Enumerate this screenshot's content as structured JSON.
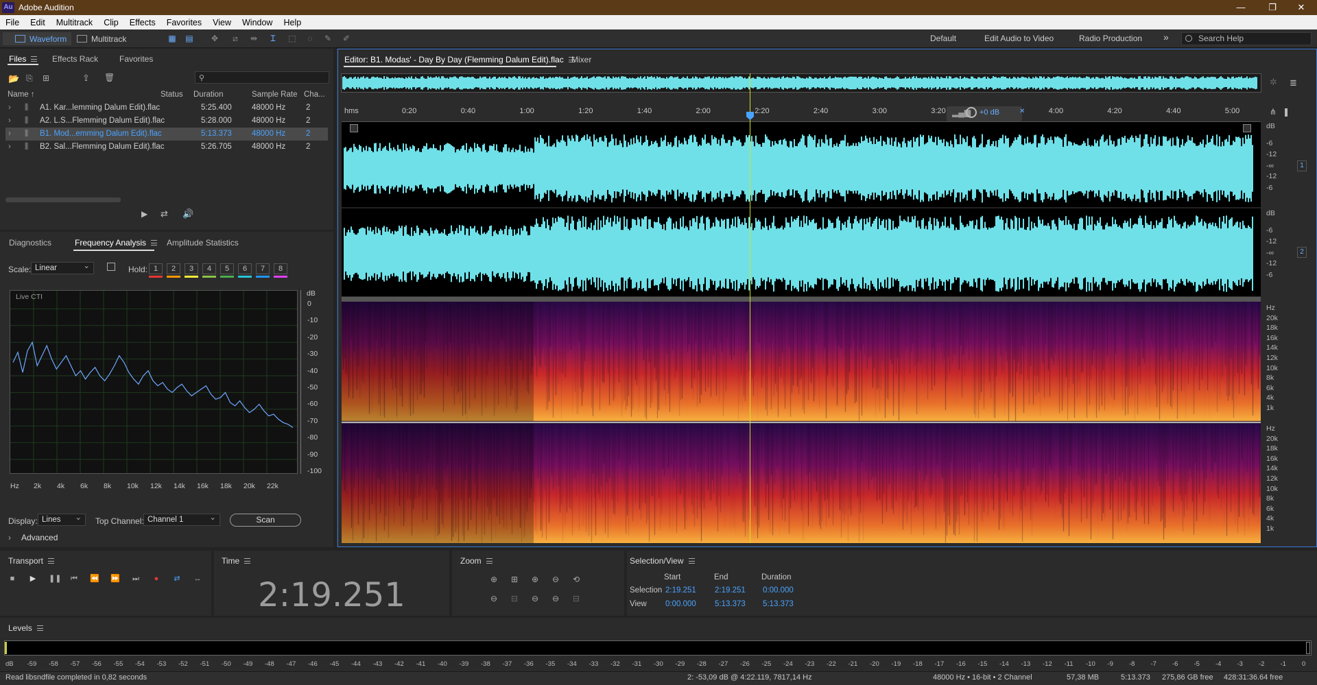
{
  "app": {
    "title": "Adobe Audition",
    "icon_label": "Au"
  },
  "window_controls": [
    "—",
    "❐",
    "✕"
  ],
  "menu": [
    "File",
    "Edit",
    "Multitrack",
    "Clip",
    "Effects",
    "Favorites",
    "View",
    "Window",
    "Help"
  ],
  "toolbar": {
    "waveform": "Waveform",
    "multitrack": "Multitrack",
    "workspaces": [
      "Default",
      "Edit Audio to Video",
      "Radio Production"
    ],
    "more": "»",
    "search_placeholder": "Search Help"
  },
  "files_panel": {
    "tabs": [
      "Files",
      "Effects Rack",
      "Favorites"
    ],
    "columns": [
      "Name ↑",
      "Status",
      "Duration",
      "Sample Rate",
      "Cha..."
    ],
    "rows": [
      {
        "name": "A1. Kar...lemming Dalum Edit).flac",
        "duration": "5:25.400",
        "rate": "48000 Hz",
        "ch": "2"
      },
      {
        "name": "A2. L.S...Flemming Dalum Edit).flac",
        "duration": "5:28.000",
        "rate": "48000 Hz",
        "ch": "2"
      },
      {
        "name": "B1. Mod...emming Dalum Edit).flac",
        "duration": "5:13.373",
        "rate": "48000 Hz",
        "ch": "2"
      },
      {
        "name": "B2. Sal...Flemming Dalum Edit).flac",
        "duration": "5:26.705",
        "rate": "48000 Hz",
        "ch": "2"
      }
    ],
    "selected_index": 2
  },
  "analysis_panel": {
    "tabs": [
      "Diagnostics",
      "Frequency Analysis",
      "Amplitude Statistics"
    ],
    "scale_label": "Scale:",
    "scale_value": "Linear",
    "hold_label": "Hold:",
    "hold_buttons": [
      "1",
      "2",
      "3",
      "4",
      "5",
      "6",
      "7",
      "8"
    ],
    "hold_colors": [
      "#e53935",
      "#ff9800",
      "#ffeb3b",
      "#8bc34a",
      "#4caf50",
      "#26c6da",
      "#2196f3",
      "#e040fb"
    ],
    "graph_title": "Live CTI",
    "db_label": "dB",
    "db_ticks": [
      "0",
      "-10",
      "-20",
      "-30",
      "-40",
      "-50",
      "-60",
      "-70",
      "-80",
      "-90",
      "-100"
    ],
    "hz_ticks": [
      "Hz",
      "2k",
      "4k",
      "6k",
      "8k",
      "10k",
      "12k",
      "14k",
      "16k",
      "18k",
      "20k",
      "22k"
    ],
    "display_label": "Display:",
    "display_value": "Lines",
    "top_channel_label": "Top Channel:",
    "top_channel_value": "Channel 1",
    "scan_button": "Scan",
    "advanced_label": "Advanced",
    "spectrum_db": [
      -42,
      -36,
      -48,
      -35,
      -30,
      -44,
      -38,
      -32,
      -40,
      -46,
      -42,
      -38,
      -44,
      -50,
      -47,
      -52,
      -48,
      -45,
      -50,
      -53,
      -49,
      -44,
      -38,
      -42,
      -48,
      -52,
      -55,
      -50,
      -47,
      -53,
      -56,
      -54,
      -58,
      -60,
      -57,
      -55,
      -59,
      -62,
      -60,
      -58,
      -56,
      -61,
      -64,
      -63,
      -60,
      -66,
      -68,
      -65,
      -69,
      -72,
      -70,
      -67,
      -71,
      -74,
      -73,
      -76,
      -78,
      -79,
      -81
    ]
  },
  "editor": {
    "tab_title": "Editor: B1. Modas' - Day By Day (Flemming Dalum Edit).flac",
    "mixer_tab": "Mixer",
    "ruler_unit": "hms",
    "ruler": [
      "0:20",
      "0:40",
      "1:00",
      "1:20",
      "1:40",
      "2:00",
      "2:20",
      "2:40",
      "3:00",
      "3:20",
      "3:40",
      "4:00",
      "4:20",
      "4:40",
      "5:00"
    ],
    "hud_gain": "+0 dB",
    "duration_seconds": 313.373,
    "cti_seconds": 139.251,
    "waveform_db_ticks": [
      "dB",
      "-6",
      "-12",
      "-∞",
      "-12",
      "-6"
    ],
    "channels": [
      "1",
      "2"
    ],
    "hz_ticks": [
      "Hz",
      "20k",
      "18k",
      "16k",
      "14k",
      "12k",
      "10k",
      "8k",
      "6k",
      "4k",
      "1k"
    ]
  },
  "transport": {
    "title": "Transport"
  },
  "time": {
    "title": "Time",
    "value": "2:19.251"
  },
  "zoom": {
    "title": "Zoom"
  },
  "selection_view": {
    "title": "Selection/View",
    "headers": [
      "Start",
      "End",
      "Duration"
    ],
    "selection_label": "Selection",
    "selection": [
      "2:19.251",
      "2:19.251",
      "0:00.000"
    ],
    "view_label": "View",
    "view": [
      "0:00.000",
      "5:13.373",
      "5:13.373"
    ]
  },
  "levels": {
    "title": "Levels",
    "ticks": [
      "dB",
      "-59",
      "-58",
      "-57",
      "-56",
      "-55",
      "-54",
      "-53",
      "-52",
      "-51",
      "-50",
      "-49",
      "-48",
      "-47",
      "-46",
      "-45",
      "-44",
      "-43",
      "-42",
      "-41",
      "-40",
      "-39",
      "-38",
      "-37",
      "-36",
      "-35",
      "-34",
      "-33",
      "-32",
      "-31",
      "-30",
      "-29",
      "-28",
      "-27",
      "-26",
      "-25",
      "-24",
      "-23",
      "-22",
      "-21",
      "-20",
      "-19",
      "-18",
      "-17",
      "-16",
      "-15",
      "-14",
      "-13",
      "-12",
      "-11",
      "-10",
      "-9",
      "-8",
      "-7",
      "-6",
      "-5",
      "-4",
      "-3",
      "-2",
      "-1",
      "0"
    ]
  },
  "statusbar": {
    "message": "Read libsndfile completed in 0,82 seconds",
    "cursor": "2: -53,09 dB @ 4:22.119, 7817,14 Hz",
    "format": "48000 Hz • 16-bit • 2 Channel",
    "size": "57,38 MB",
    "length": "5:13.373",
    "free": "275,86 GB free",
    "free_time": "428:31:36.64 free"
  }
}
